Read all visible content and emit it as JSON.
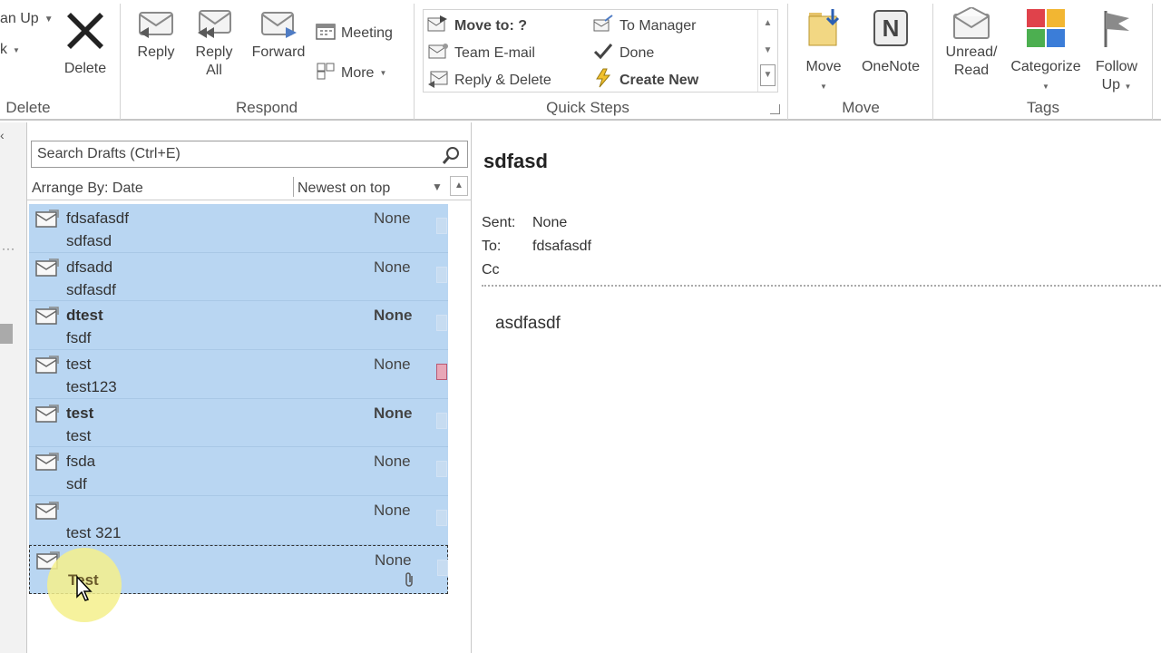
{
  "ribbon": {
    "cleanup_partial": "an Up",
    "junk_partial": "k",
    "delete": {
      "label": "Delete",
      "group_label": "Delete"
    },
    "respond": {
      "group_label": "Respond",
      "reply": "Reply",
      "reply_all_line1": "Reply",
      "reply_all_line2": "All",
      "forward": "Forward",
      "meeting": "Meeting",
      "more": "More"
    },
    "quick_steps": {
      "group_label": "Quick Steps",
      "items": [
        "Move to: ?",
        "Team E-mail",
        "Reply & Delete",
        "To Manager",
        "Done",
        "Create New"
      ]
    },
    "move": {
      "group_label": "Move",
      "move": "Move",
      "onenote": "OneNote"
    },
    "tags": {
      "group_label": "Tags",
      "unread_line1": "Unread/",
      "unread_line2": "Read",
      "categorize": "Categorize",
      "follow_line1": "Follow",
      "follow_line2": "Up"
    }
  },
  "list": {
    "search_placeholder": "Search Drafts (Ctrl+E)",
    "arrange_by": "Arrange By: Date",
    "sort_order": "Newest on top",
    "items": [
      {
        "sender": "fdsafasdf",
        "subject": "sdfasd",
        "category": "None",
        "flag": "none"
      },
      {
        "sender": "dfsadd",
        "subject": "sdfasdf",
        "category": "None",
        "flag": "none"
      },
      {
        "sender": "dtest",
        "subject": "fsdf",
        "category": "None",
        "flag": "none"
      },
      {
        "sender": "test",
        "subject": "test123",
        "category": "None",
        "flag": "red"
      },
      {
        "sender": "test",
        "subject": "test",
        "category": "None",
        "flag": "none"
      },
      {
        "sender": "fsda",
        "subject": "sdf",
        "category": "None",
        "flag": "none"
      },
      {
        "sender": "",
        "subject": "test 321",
        "category": "None",
        "flag": "none"
      },
      {
        "sender": "",
        "subject": "Test",
        "category": "None",
        "flag": "none",
        "attachment": true
      }
    ]
  },
  "reading": {
    "subject": "sdfasd",
    "sent_label": "Sent:",
    "sent_value": "None",
    "to_label": "To:",
    "to_value": "fdsafasdf",
    "cc_label": "Cc",
    "body": "asdfasdf"
  }
}
